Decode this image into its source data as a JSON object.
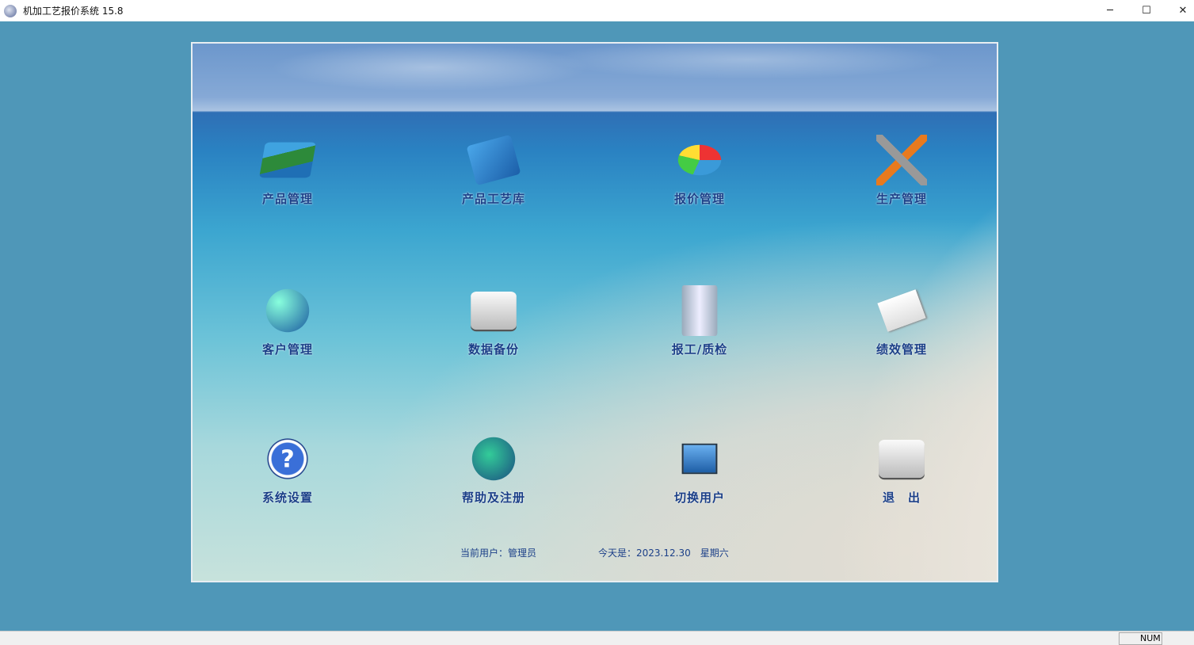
{
  "window": {
    "title": "机加工艺报价系统 15.8",
    "minimize": "─",
    "maximize": "☐",
    "close": "✕"
  },
  "menu": [
    {
      "label": "产品管理",
      "icon": "books-icon"
    },
    {
      "label": "产品工艺库",
      "icon": "binder-icon"
    },
    {
      "label": "报价管理",
      "icon": "pie-chart-icon"
    },
    {
      "label": "生产管理",
      "icon": "tools-icon"
    },
    {
      "label": "客户管理",
      "icon": "globe-monitor-icon"
    },
    {
      "label": "数据备份",
      "icon": "drive-icon"
    },
    {
      "label": "报工/质检",
      "icon": "server-icon"
    },
    {
      "label": "绩效管理",
      "icon": "document-pen-icon"
    },
    {
      "label": "系统设置",
      "icon": "help-icon"
    },
    {
      "label": "帮助及注册",
      "icon": "globe-arrows-icon"
    },
    {
      "label": "切换用户",
      "icon": "monitors-icon"
    },
    {
      "label": "退　出",
      "icon": "download-drive-icon"
    }
  ],
  "status": {
    "user": "当前用户：管理员",
    "date": "今天是：2023.12.30　星期六"
  },
  "statusbar": {
    "num": "NUM"
  }
}
